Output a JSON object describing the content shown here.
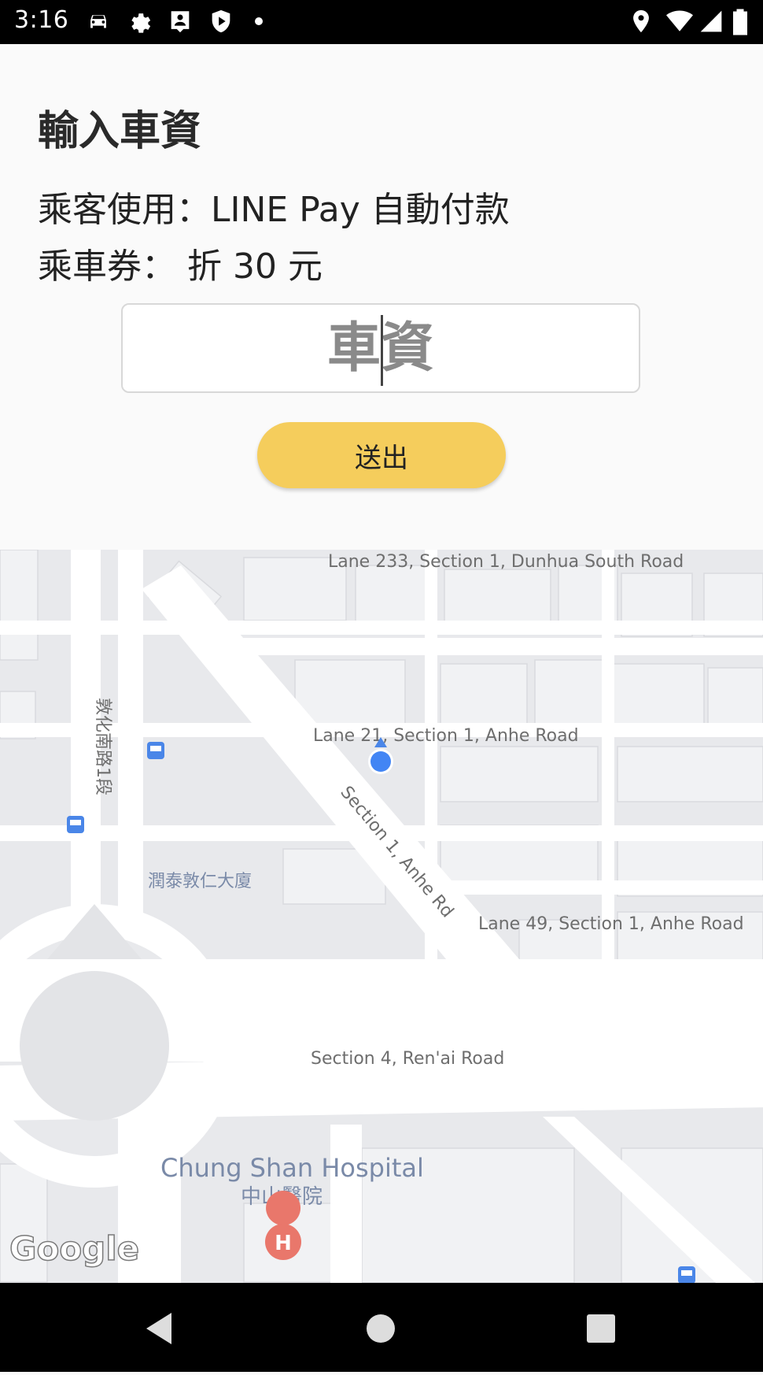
{
  "status_bar": {
    "time": "3:16",
    "icons": [
      "car-icon",
      "gear-icon",
      "contact-card-icon",
      "shield-play-icon",
      "dot-icon",
      "location-icon",
      "wifi-icon",
      "signal-icon",
      "battery-icon"
    ]
  },
  "form": {
    "title": "輸入車資",
    "payment_line": "乘客使用：LINE Pay 自動付款",
    "coupon_line": "乘車券：  折 30 元",
    "fare_placeholder": "車資",
    "fare_value": "",
    "submit_label": "送出",
    "accent_color": "#f5cd5c"
  },
  "map": {
    "street_labels": {
      "lane233": "Lane 233, Section 1, Dunhua South Road",
      "lane21": "Lane 21, Section 1, Anhe Road",
      "anhe": "Section 1, Anhe Rd",
      "lane49": "Lane 49, Section 1, Anhe Road",
      "renai": "Section 4, Ren'ai Road",
      "dunhua_south": "敦化南路1段"
    },
    "poi": {
      "building": "潤泰敦仁大廈",
      "hospital_en": "Chung Shan Hospital",
      "hospital_zh": "中山醫院"
    },
    "attribution": "Google",
    "location_dot_color": "#4285f4"
  },
  "nav_bar": {
    "buttons": [
      "back-icon",
      "home-icon",
      "recents-icon"
    ]
  }
}
